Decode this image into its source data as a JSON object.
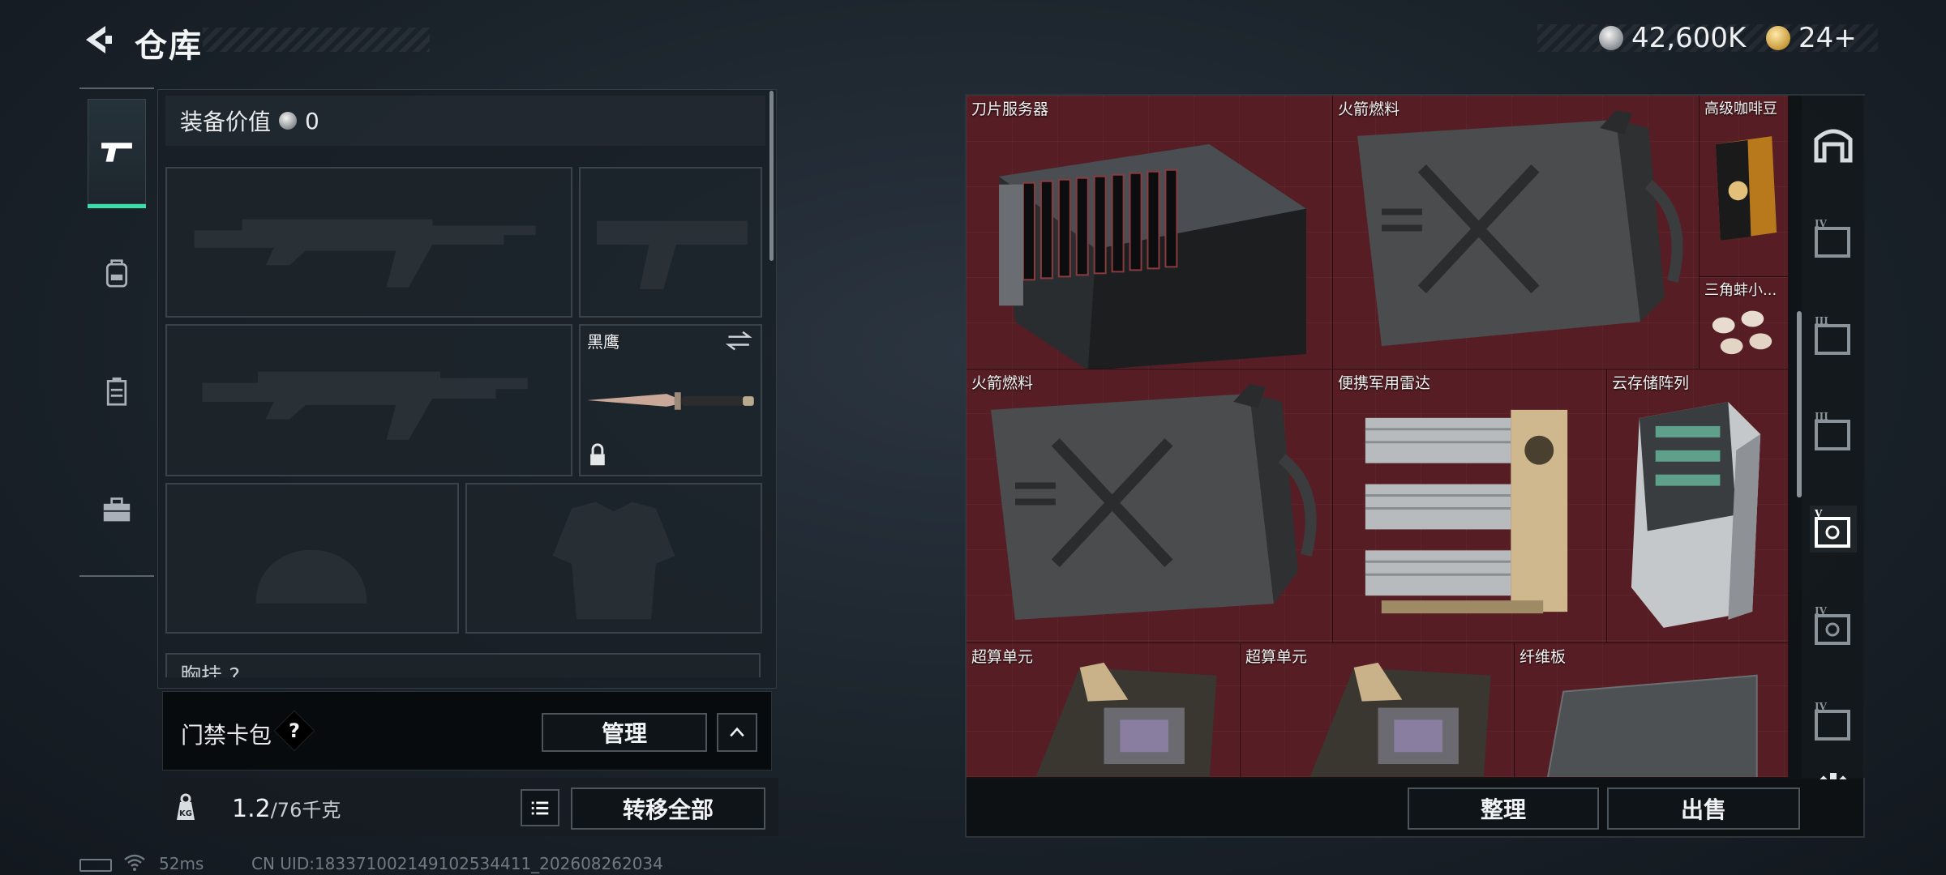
{
  "header": {
    "title": "仓库",
    "currency_silver": "42,600K",
    "currency_gold": "24+"
  },
  "tabs": [
    {
      "icon": "pistol-icon",
      "active": true
    },
    {
      "icon": "backpack-icon",
      "active": false
    },
    {
      "icon": "vest-icon",
      "active": false
    },
    {
      "icon": "briefcase-icon",
      "active": false
    }
  ],
  "equipment": {
    "value_label": "装备价值",
    "value": "0",
    "melee_slot_label": "黑鹰",
    "partial_slot_label": "胸挂 ?",
    "keycard_label": "门禁卡包",
    "help_label": "?",
    "manage_label": "管理",
    "weight_current": "1.2",
    "weight_max": "/76千克",
    "transfer_all_label": "转移全部"
  },
  "storage": {
    "items": [
      {
        "name": "刀片服务器",
        "icon": "blade-server-icon"
      },
      {
        "name": "火箭燃料",
        "icon": "fuel-can-icon"
      },
      {
        "name": "高级咖啡豆",
        "icon": "coffee-bag-icon"
      },
      {
        "name": "三角蚌小...",
        "icon": "pearls-icon"
      },
      {
        "name": "火箭燃料",
        "icon": "fuel-can-icon"
      },
      {
        "name": "便携军用雷达",
        "icon": "radar-icon"
      },
      {
        "name": "云存储阵列",
        "icon": "storage-array-icon"
      },
      {
        "name": "超算单元",
        "icon": "compute-unit-icon"
      },
      {
        "name": "超算单元",
        "icon": "compute-unit-icon"
      },
      {
        "name": "纤维板",
        "icon": "fiberboard-icon"
      }
    ],
    "sort_label": "整理",
    "sell_label": "出售"
  },
  "status": {
    "ping": "52ms",
    "uid": "CN UID:1833710021491025344​11_202608262034"
  },
  "colors": {
    "grid_bg": "#5a1f24",
    "accent": "#36e0a8"
  }
}
